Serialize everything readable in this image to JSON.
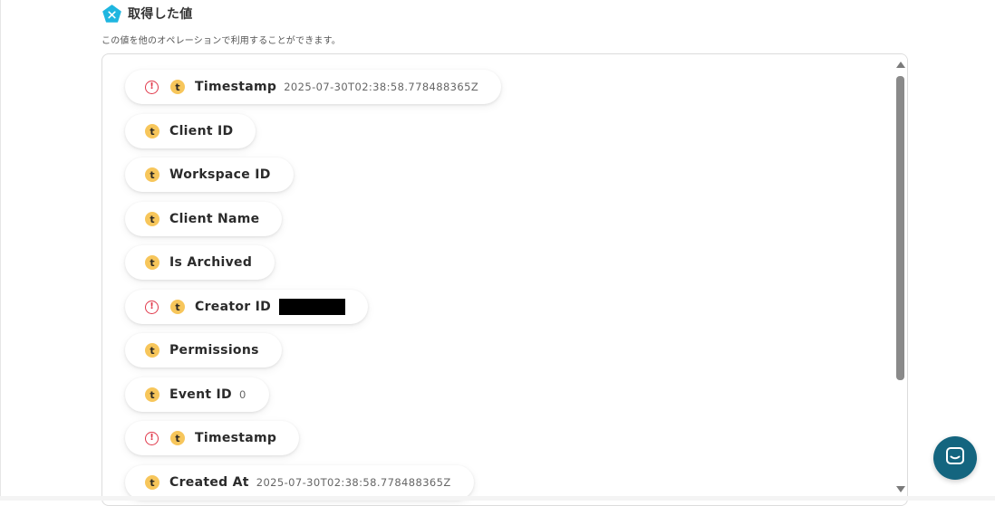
{
  "section": {
    "title": "取得した値",
    "subtitle": "この値を他のオペレーションで利用することができます。",
    "icon": "pentagon-badge-icon"
  },
  "colors": {
    "badge": "#1fb6e0",
    "warning": "#e0384a",
    "token_icon": "#f7c65b",
    "chat_button": "#14657f"
  },
  "items": [
    {
      "label": "Timestamp",
      "value": "2025-07-30T02:38:58.778488365Z",
      "warning": true
    },
    {
      "label": "Client ID",
      "value": "",
      "warning": false
    },
    {
      "label": "Workspace ID",
      "value": "",
      "warning": false
    },
    {
      "label": "Client Name",
      "value": "",
      "warning": false
    },
    {
      "label": "Is Archived",
      "value": "",
      "warning": false
    },
    {
      "label": "Creator ID",
      "value": "",
      "warning": true,
      "redacted": true
    },
    {
      "label": "Permissions",
      "value": "",
      "warning": false
    },
    {
      "label": "Event ID",
      "value": "0",
      "warning": false
    },
    {
      "label": "Timestamp",
      "value": "",
      "warning": true
    },
    {
      "label": "Created At",
      "value": "2025-07-30T02:38:58.778488365Z",
      "warning": false
    }
  ],
  "icon_glyph": "t",
  "warning_glyph": "!",
  "chat": {
    "icon": "chat-bubble-icon"
  }
}
